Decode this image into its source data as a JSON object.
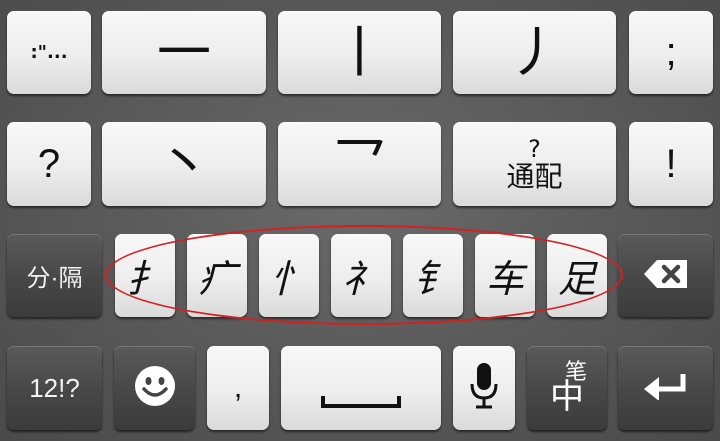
{
  "keyboard": {
    "row1": {
      "punct": ":\"...",
      "stroke_heng": "一",
      "stroke_shu": "丨",
      "stroke_pie": "丿",
      "semicolon": ";"
    },
    "row2": {
      "question": "?",
      "stroke_dian": "丶",
      "stroke_zhe": "乛",
      "wildcard_top": "?",
      "wildcard_label": "通配",
      "exclaim": "!"
    },
    "row3": {
      "separator": "分·隔",
      "radicals": [
        "扌",
        "疒",
        "忄",
        "礻",
        "钅",
        "车",
        "足"
      ]
    },
    "row4": {
      "number_switch": "12!?",
      "comma": ",",
      "lang_top": "笔",
      "lang_bottom": "中"
    }
  },
  "icons": {
    "backspace": "backspace-icon",
    "emoji": "smiley-icon",
    "microphone": "microphone-icon",
    "enter": "enter-arrow-icon",
    "space": "space-bar-icon"
  },
  "colors": {
    "highlight_ellipse": "#d42020"
  }
}
